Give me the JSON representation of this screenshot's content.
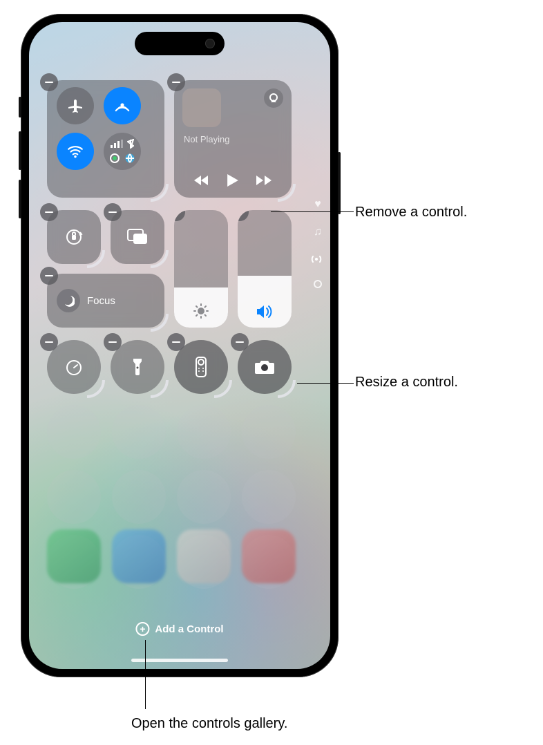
{
  "media": {
    "status": "Not Playing"
  },
  "focus": {
    "label": "Focus"
  },
  "add_control": {
    "label": "Add a Control"
  },
  "callouts": {
    "remove": "Remove a control.",
    "resize": "Resize a control.",
    "gallery": "Open the controls gallery."
  },
  "icons": {
    "airplane": "airplane-icon",
    "airdrop": "airdrop-icon",
    "wifi": "wifi-icon",
    "cellular": "cellular-icon",
    "bluetooth": "bluetooth-icon",
    "hotspot": "hotspot-icon",
    "satellite": "satellite-icon",
    "airplay": "airplay-icon",
    "prev": "previous-track-icon",
    "play": "play-icon",
    "next": "next-track-icon",
    "lock": "orientation-lock-icon",
    "mirror": "screen-mirroring-icon",
    "brightness": "brightness-icon",
    "volume": "volume-icon",
    "moon": "moon-icon",
    "timer": "timer-icon",
    "torch": "flashlight-icon",
    "remote": "apple-tv-remote-icon",
    "camera": "camera-icon",
    "heart": "favorites-page-icon",
    "music": "music-page-icon",
    "radio": "connectivity-page-icon",
    "plus": "plus-icon",
    "minus": "remove-icon"
  },
  "brightness_pct": 34,
  "volume_pct": 44
}
